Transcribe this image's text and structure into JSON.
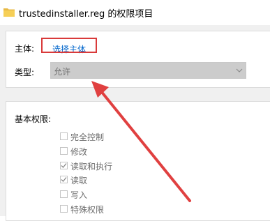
{
  "window": {
    "title": "trustedinstaller.reg 的权限项目",
    "icon": "folder-icon"
  },
  "principal": {
    "label": "主体:",
    "link_text": "选择主体"
  },
  "type": {
    "label": "类型:",
    "value": "允许"
  },
  "basic_permissions": {
    "label": "基本权限:",
    "items": [
      {
        "label": "完全控制",
        "checked": false
      },
      {
        "label": "修改",
        "checked": false
      },
      {
        "label": "读取和执行",
        "checked": true
      },
      {
        "label": "读取",
        "checked": true
      },
      {
        "label": "写入",
        "checked": false
      },
      {
        "label": "特殊权限",
        "checked": false
      }
    ]
  },
  "annotation": {
    "highlight_color": "#d93a3a"
  }
}
